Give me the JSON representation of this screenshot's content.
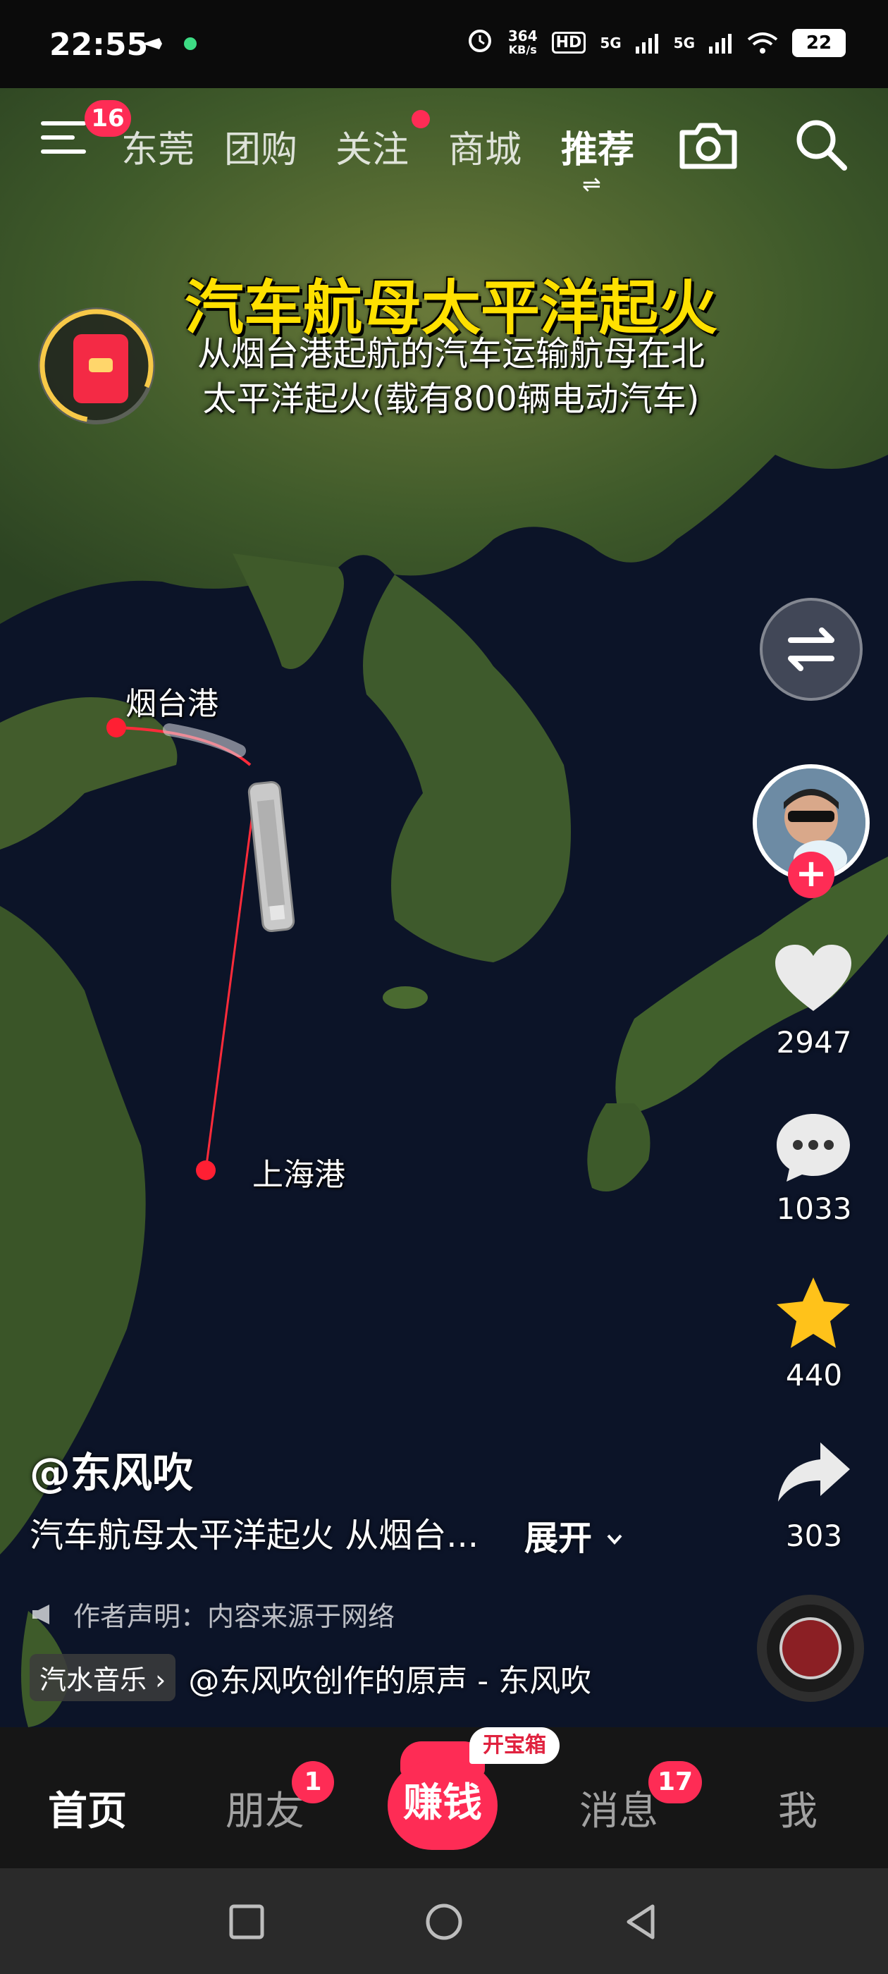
{
  "status_bar": {
    "time": "22:55",
    "net_speed_value": "364",
    "net_speed_unit": "KB/s",
    "hd_label": "HD",
    "signal_1": "5G",
    "signal_2": "5G",
    "battery": "22"
  },
  "top_nav": {
    "menu_badge": "16",
    "tabs": [
      "东莞",
      "团购",
      "关注",
      "商城",
      "推荐"
    ],
    "active_tab": "推荐"
  },
  "video": {
    "title": "汽车航母太平洋起火",
    "subtitle_line1": "从烟台港起航的汽车运输航母在北",
    "subtitle_line2": "太平洋起火(载有800辆电动汽车)",
    "map_labels": {
      "origin": "烟台港",
      "destination": "上海港"
    }
  },
  "right_rail": {
    "likes": "2947",
    "comments": "1033",
    "favorites": "440",
    "shares": "303"
  },
  "caption": {
    "author": "@东风吹",
    "text": "汽车航母太平洋起火 从烟台...",
    "expand_label": "展开",
    "declaration": "作者声明：内容来源于网络",
    "music_tag": "汽水音乐",
    "music_title": "@东风吹创作的原声 - 东风吹"
  },
  "bottom_nav": {
    "home": "首页",
    "friends": "朋友",
    "friends_badge": "1",
    "earn": "赚钱",
    "chest_label": "开宝箱",
    "messages": "消息",
    "messages_badge": "17",
    "me": "我"
  },
  "colors": {
    "accent": "#fe2c55",
    "title_yellow": "#ffe000",
    "ocean": "#0c1428",
    "land": "#3f5a2a"
  }
}
